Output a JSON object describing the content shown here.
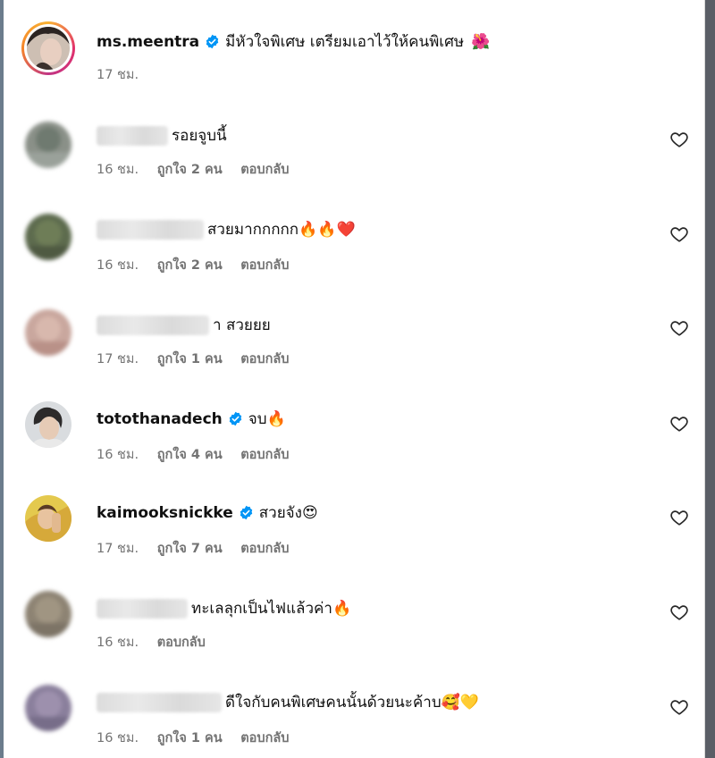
{
  "post": {
    "username": "ms.meentra",
    "caption": "มีหัวใจพิเศษ เตรียมเอาไว้ให้คนพิเศษ",
    "caption_emoji": "🌺",
    "time": "17 ชม."
  },
  "comments": [
    {
      "username": "",
      "text": "รอยจูบนี้",
      "emoji": "",
      "time": "16 ชม.",
      "likes": "ถูกใจ 2 คน",
      "reply": "ตอบกลับ"
    },
    {
      "username": "",
      "text": "สวยมากกกกก",
      "emoji": "🔥🔥❤️",
      "time": "16 ชม.",
      "likes": "ถูกใจ 2 คน",
      "reply": "ตอบกลับ"
    },
    {
      "username": "",
      "text": "า สวยยย",
      "emoji": "",
      "time": "17 ชม.",
      "likes": "ถูกใจ 1 คน",
      "reply": "ตอบกลับ"
    },
    {
      "username": "totothanadech",
      "text": "จบ",
      "emoji": "🔥",
      "time": "16 ชม.",
      "likes": "ถูกใจ 4 คน",
      "reply": "ตอบกลับ"
    },
    {
      "username": "kaimooksnickke",
      "text": "สวยจัง",
      "emoji": "😍",
      "time": "17 ชม.",
      "likes": "ถูกใจ 7 คน",
      "reply": "ตอบกลับ"
    },
    {
      "username": "",
      "text": "ทะเลลุกเป็นไฟแล้วค่า",
      "emoji": "🔥",
      "time": "16 ชม.",
      "likes": "",
      "reply": "ตอบกลับ"
    },
    {
      "username": "",
      "text": "ดีใจกับคนพิเศษคนนั้นด้วยนะค้าบ",
      "emoji": "🥰💛",
      "time": "16 ชม.",
      "likes": "ถูกใจ 1 คน",
      "reply": "ตอบกลับ"
    }
  ],
  "colors": {
    "verified": "#0095f6",
    "meta_text": "#737373",
    "heart_stroke": "#262626"
  },
  "icons": {
    "verified": "verified-badge-icon",
    "like": "heart-outline-icon"
  }
}
